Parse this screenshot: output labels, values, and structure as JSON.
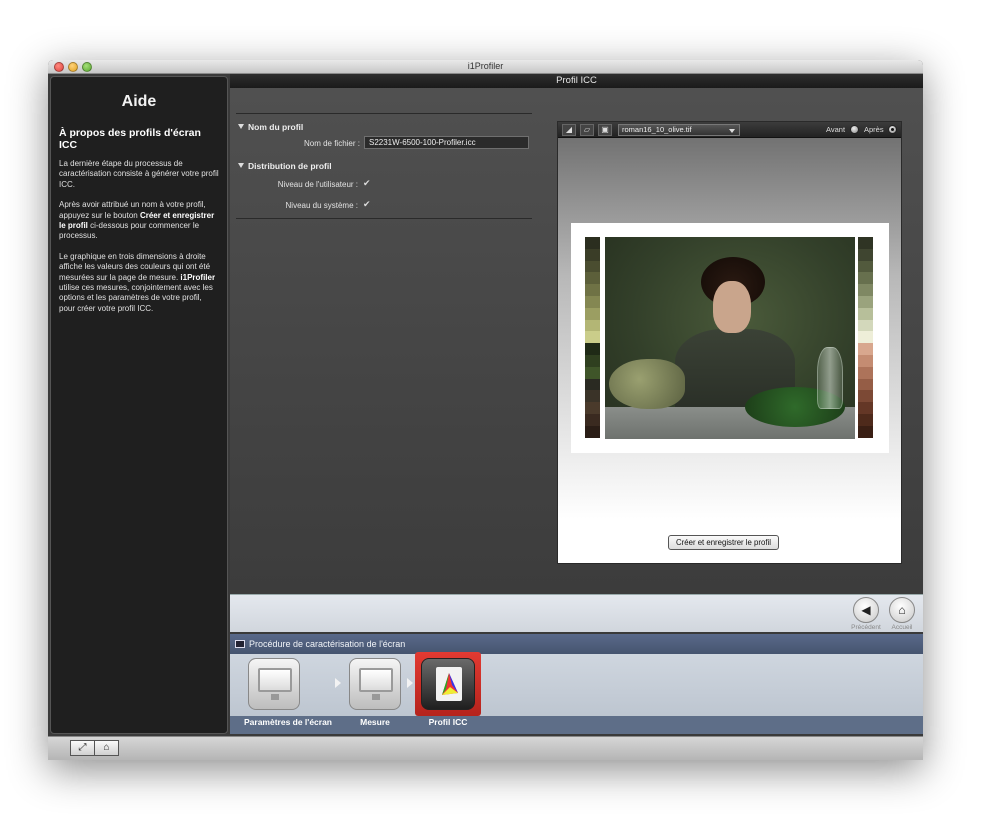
{
  "window": {
    "title": "i1Profiler"
  },
  "header": {
    "title": "Profil ICC"
  },
  "help": {
    "title": "Aide",
    "subtitle": "À propos des profils d'écran ICC",
    "para1": "La dernière étape du processus de caractérisation consiste à générer votre profil ICC.",
    "para2_a": "Après avoir attribué un nom à votre profil, appuyez sur le bouton ",
    "para2_bold": "Créer et enregistrer le profil",
    "para2_b": " ci-dessous pour commencer le processus.",
    "para3_a": "Le graphique en trois dimensions à droite affiche les valeurs des couleurs qui ont été mesurées sur la page de mesure. ",
    "para3_bold": "i1Profiler",
    "para3_b": " utilise ces mesures, conjointement avec les options et les paramètres de votre profil, pour créer votre profil ICC."
  },
  "profile_name": {
    "section": "Nom du profil",
    "file_label": "Nom de fichier :",
    "file_value": "S2231W-6500-100-Profiler.icc"
  },
  "distribution": {
    "section": "Distribution de profil",
    "user_level_label": "Niveau de l'utilisateur :",
    "user_level_checked": true,
    "system_level_label": "Niveau du système :",
    "system_level_checked": true,
    "check_glyph": "✔"
  },
  "preview": {
    "image_select": "roman16_10_olive.tif",
    "before_label": "Avant",
    "after_label": "Après",
    "selected": "after",
    "left_swatches": [
      "#2b2e1f",
      "#3a3d27",
      "#4a4d30",
      "#5c5f3a",
      "#6f7245",
      "#848752",
      "#9b9e62",
      "#b3b675",
      "#cacd8a",
      "#1f2a16",
      "#2f3f1f",
      "#3f5529",
      "#2a2a22",
      "#3a3328",
      "#4a3a2b",
      "#3a2a20",
      "#2a1d16"
    ],
    "right_swatches": [
      "#2f3424",
      "#3f4530",
      "#525a3d",
      "#67704e",
      "#7f8863",
      "#9aa37d",
      "#b7bf9a",
      "#d3d8bb",
      "#eeeed8",
      "#d8a78e",
      "#c48c72",
      "#ad735a",
      "#955d46",
      "#7c4935",
      "#643726",
      "#4e2a1b",
      "#3a1f14"
    ],
    "save_button": "Créer et enregistrer le profil"
  },
  "nav": {
    "back_label": "Précédent",
    "home_label": "Accueil",
    "back_glyph": "◀",
    "home_glyph": "⌂"
  },
  "workflow": {
    "title": "Procédure de caractérisation de l'écran",
    "steps": [
      {
        "label": "Paramètres de l'écran",
        "active": false
      },
      {
        "label": "Mesure",
        "active": false
      },
      {
        "label": "Profil ICC",
        "active": true
      }
    ]
  },
  "footer": {
    "fit_glyph": "⤢",
    "home_glyph": "⌂"
  },
  "colors": {
    "accent_active_step": "#d12f28",
    "workflow_header": "#4f5f7c",
    "help_bg": "#1f1f1f"
  }
}
